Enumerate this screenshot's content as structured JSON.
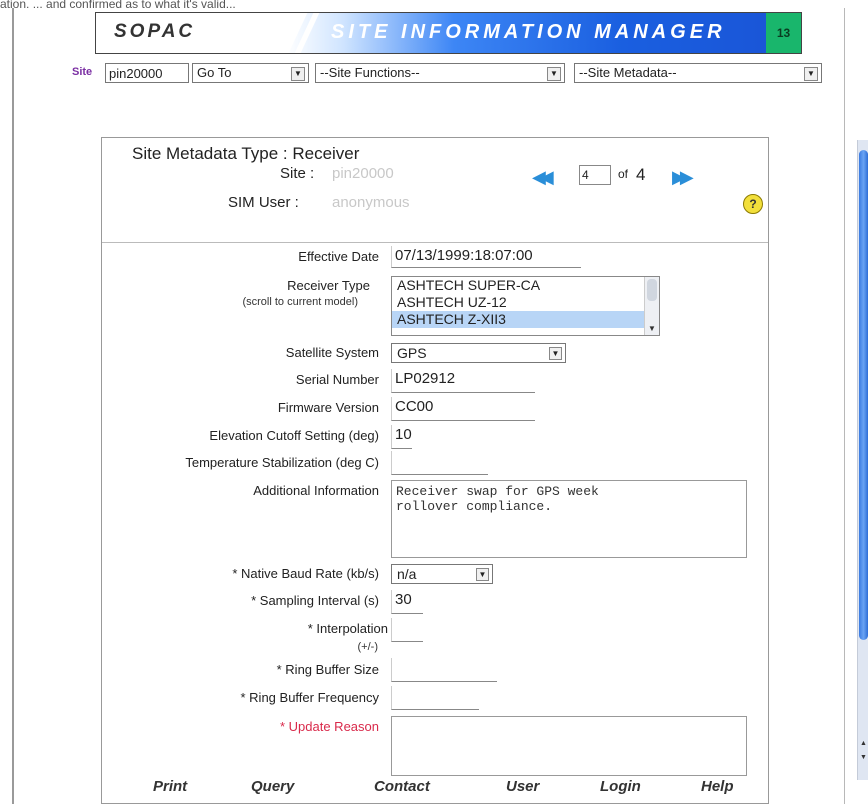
{
  "top_strip_text": "ation, ... and confirmed as to what it's valid...",
  "banner": {
    "left_title": "SOPAC",
    "title": "SITE INFORMATION MANAGER",
    "version": "13"
  },
  "nav": {
    "site_label": "Site",
    "site_value": "pin20000",
    "goto_select": "Go To",
    "site_functions_select": "--Site Functions--",
    "site_metadata_select": "--Site Metadata--"
  },
  "header": {
    "metadata_type_label": "Site Metadata Type : Receiver",
    "site_label": "Site :",
    "site_value": "pin20000",
    "user_label": "SIM User :",
    "user_value": "anonymous",
    "page_current": "4",
    "page_of": "of",
    "page_total": "4",
    "help_icon": "?"
  },
  "form": {
    "effective_date_label": "Effective Date",
    "effective_date_value": "07/13/1999:18:07:00",
    "receiver_type_label": "Receiver Type",
    "receiver_type_sub": "(scroll to current model)",
    "receiver_options": [
      "ASHTECH SUPER-CA",
      "ASHTECH UZ-12",
      "ASHTECH Z-XII3"
    ],
    "receiver_selected": "ASHTECH Z-XII3",
    "satellite_label": "Satellite System",
    "satellite_value": "GPS",
    "serial_label": "Serial Number",
    "serial_value": "LP02912",
    "firmware_label": "Firmware Version",
    "firmware_value": "CC00",
    "elevation_label": "Elevation Cutoff Setting (deg)",
    "elevation_value": "10",
    "temp_label": "Temperature Stabilization (deg C)",
    "temp_value": "",
    "additional_label": "Additional Information",
    "additional_value": "Receiver swap for GPS week\nrollover compliance.",
    "baud_label": "* Native Baud Rate (kb/s)",
    "baud_value": "n/a",
    "sampling_label": "* Sampling Interval (s)",
    "sampling_value": "30",
    "interp_label": "* Interpolation",
    "interp_sub": "(+/-)",
    "ring_size_label": "* Ring Buffer Size",
    "ring_freq_label": "* Ring Buffer Frequency",
    "update_label": "* Update Reason"
  },
  "footer": {
    "print": "Print",
    "query": "Query",
    "contact": "Contact",
    "user": "User",
    "login": "Login",
    "help": "Help"
  }
}
